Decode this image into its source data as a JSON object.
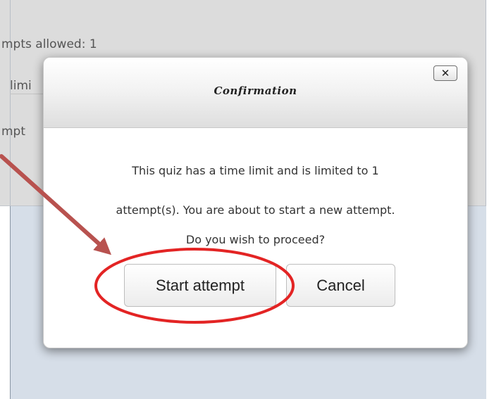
{
  "background": {
    "text_line_1": "mpts allowed: 1",
    "text_line_2": "limi",
    "text_line_3": "mpt"
  },
  "dialog": {
    "title": "Confirmation",
    "close_label": "✕",
    "message_line_1": "This quiz has a time limit and is limited to 1",
    "message_line_2": "attempt(s). You are about to start a new attempt.",
    "message_line_3": "Do you wish to proceed?",
    "start_button_label": "Start attempt",
    "cancel_button_label": "Cancel"
  },
  "annotations": {
    "arrow_color": "#b8524f",
    "ellipse_color": "#e32424"
  }
}
